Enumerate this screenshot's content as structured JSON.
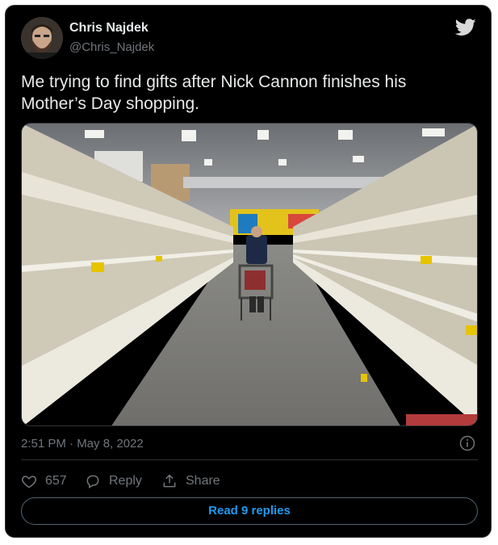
{
  "author": {
    "name": "Chris Najdek",
    "handle": "@Chris_Najdek",
    "avatar_icon": "user-avatar",
    "logo_icon": "twitter-bird-icon"
  },
  "tweet": {
    "text": "Me trying to find gifts after Nick Cannon finishes his Mother’s Day shopping."
  },
  "media": {
    "image": "photo-empty-store-aisle"
  },
  "meta": {
    "timestamp": "2:51 PM · May 8, 2022",
    "info_icon": "info-icon"
  },
  "actions": {
    "like_icon": "heart-icon",
    "like_count": "657",
    "reply_icon": "speech-bubble-icon",
    "reply_label": "Reply",
    "share_icon": "upload-icon",
    "share_label": "Share"
  },
  "read_replies": "Read 9 replies",
  "colors": {
    "background": "#000000",
    "text_primary": "#e7e9ea",
    "text_secondary": "#71767b",
    "accent": "#1d9bf0",
    "border": "#2f3336"
  }
}
